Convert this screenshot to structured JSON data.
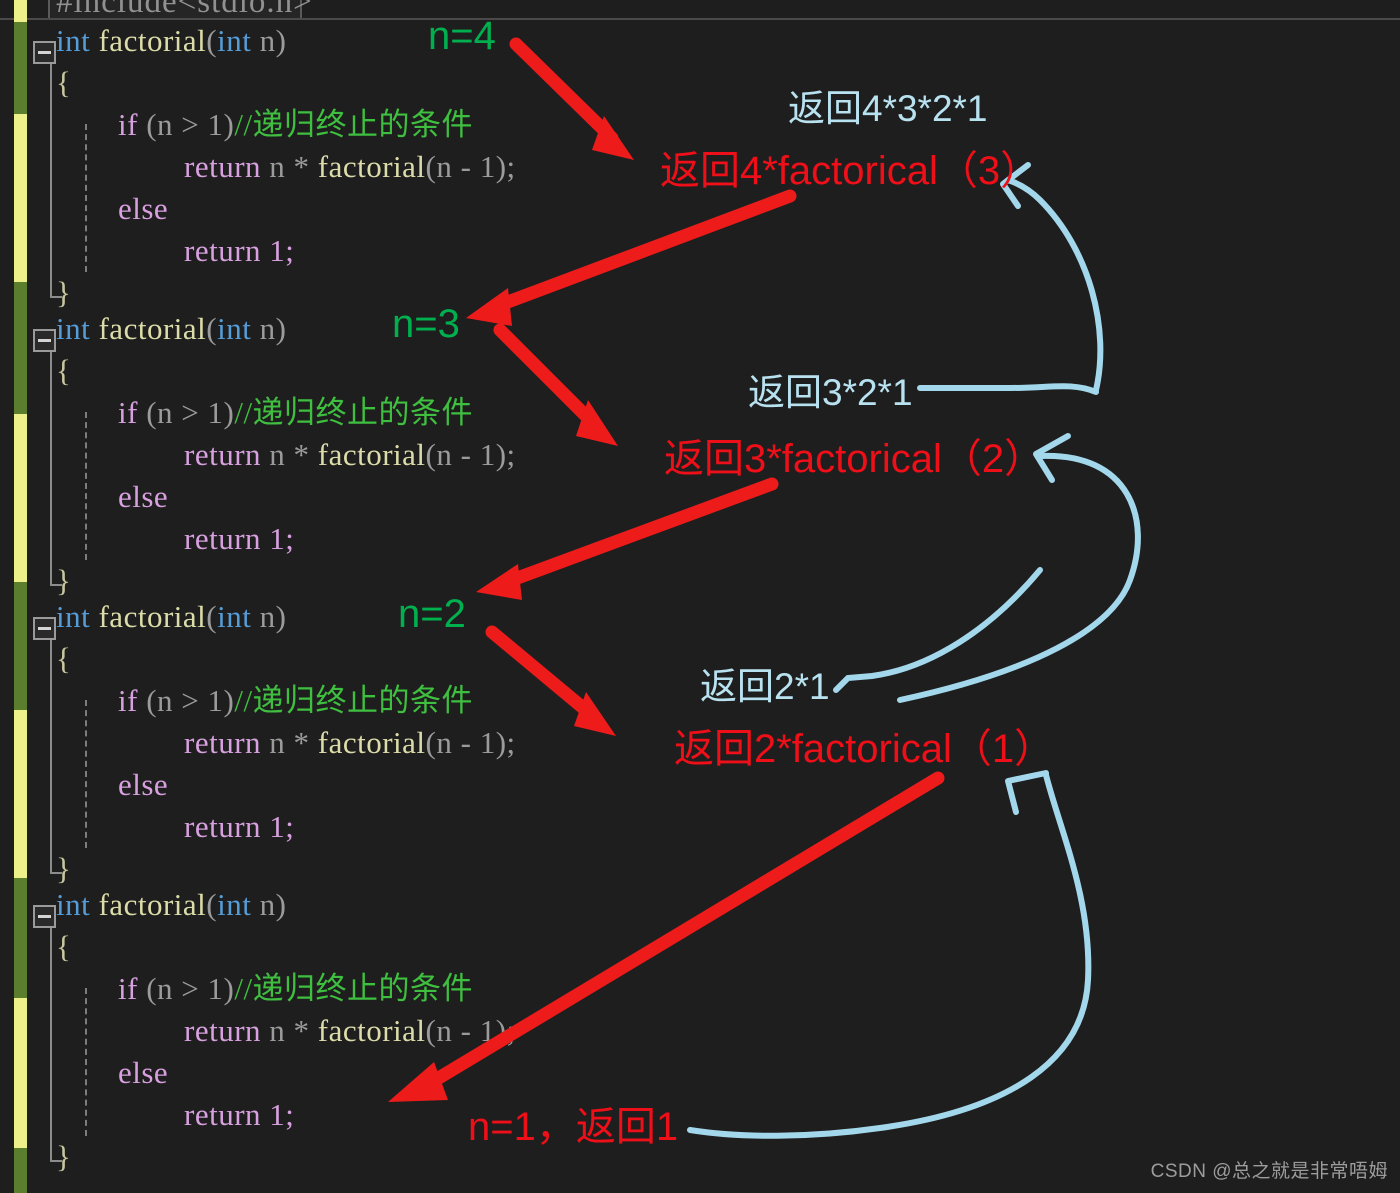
{
  "editor": {
    "background": "#1e1e1e",
    "partial_top_line": "#include<stdio.h>",
    "colors": {
      "keyword": "#569cd6",
      "function": "#dcdcaa",
      "control": "#d8a0df",
      "comment": "#3fbf3f",
      "identifier": "#9b9b9b",
      "number": "#b5cea8",
      "brace": "#c8c8a0",
      "change_saved": "#5a7d2e",
      "change_unsaved": "#eef08a"
    },
    "blocks": [
      {
        "id": "block-1",
        "lines": [
          "int factorial(int n)",
          "{",
          "    if (n > 1)//递归终止的条件",
          "        return n * factorial(n - 1);",
          "    else",
          "        return 1;",
          "}"
        ]
      },
      {
        "id": "block-2",
        "lines": [
          "int factorial(int n)",
          "{",
          "    if (n > 1)//递归终止的条件",
          "        return n * factorial(n - 1);",
          "    else",
          "        return 1;",
          "}"
        ]
      },
      {
        "id": "block-3",
        "lines": [
          "int factorial(int n)",
          "{",
          "    if (n > 1)//递归终止的条件",
          "        return n * factorial(n - 1);",
          "    else",
          "        return 1;",
          "}"
        ]
      },
      {
        "id": "block-4",
        "lines": [
          "int factorial(int n)",
          "{",
          "    if (n > 1)//递归终止的条件",
          "        return n * factorial(n - 1);",
          "    else",
          "        return 1;",
          "}"
        ]
      }
    ],
    "code_tokens": {
      "int": "int",
      "space": " ",
      "factorial": "factorial",
      "open_paren": "(",
      "close_paren": ")",
      "n": "n",
      "open_brace": "{",
      "close_brace": "}",
      "if": "if",
      "cond": "(n > 1)",
      "comment": "//递归终止的条件",
      "return": "return",
      "mul_expr": "n * ",
      "arg": "(n - 1);",
      "else": "else",
      "return_one": "return 1;"
    }
  },
  "annotations": {
    "green_labels": [
      {
        "name": "n-label-4",
        "text": "n=4",
        "color": "#00b04f"
      },
      {
        "name": "n-label-3",
        "text": "n=3",
        "color": "#00b04f"
      },
      {
        "name": "n-label-2",
        "text": "n=2",
        "color": "#00b04f"
      }
    ],
    "red_labels": [
      {
        "name": "return-expr-4",
        "text": "返回4*factorical（3）",
        "color": "#ee0f18"
      },
      {
        "name": "return-expr-3",
        "text": "返回3*factorical（2）",
        "color": "#ee0f18"
      },
      {
        "name": "return-expr-2",
        "text": "返回2*factorical（1）",
        "color": "#ee0f18"
      },
      {
        "name": "base-case-label",
        "text": "n=1，返回1",
        "color": "#ee0f18"
      }
    ],
    "blue_labels": [
      {
        "name": "result-4",
        "text": "返回4*3*2*1",
        "color": "#b9e2f0"
      },
      {
        "name": "result-3",
        "text": "返回3*2*1",
        "color": "#b9e2f0"
      },
      {
        "name": "result-2",
        "text": "返回2*1",
        "color": "#b9e2f0"
      }
    ],
    "arrow_color_red": "#ee1b1b",
    "arrow_color_blue": "#a3d8ec"
  },
  "watermark": {
    "text": "CSDN @总之就是非常唔姆"
  }
}
